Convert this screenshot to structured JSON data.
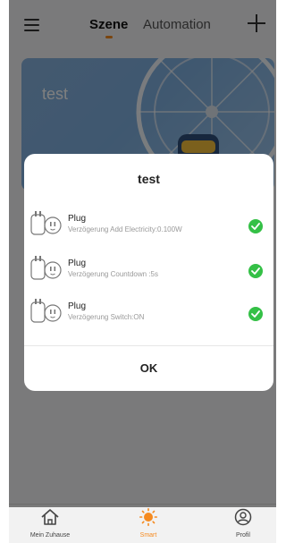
{
  "header": {
    "menu_icon": "hamburger-menu-icon",
    "tabs": [
      {
        "label": "Szene",
        "active": true
      },
      {
        "label": "Automation",
        "active": false
      }
    ],
    "add_icon": "plus-icon"
  },
  "scene_card": {
    "title": "test"
  },
  "dialog": {
    "title": "test",
    "tasks": [
      {
        "name": "Plug",
        "description": "Verzögerung Add Electricity:0.100W",
        "status": "success"
      },
      {
        "name": "Plug",
        "description": "Verzögerung Countdown :5s",
        "status": "success"
      },
      {
        "name": "Plug",
        "description": "Verzögerung Switch:ON",
        "status": "success"
      }
    ],
    "ok_label": "OK"
  },
  "bottom_nav": {
    "items": [
      {
        "label": "Mein Zuhause",
        "icon": "home-icon",
        "active": false
      },
      {
        "label": "Smart",
        "icon": "sun-icon",
        "active": true
      },
      {
        "label": "Profil",
        "icon": "user-icon",
        "active": false
      }
    ]
  },
  "colors": {
    "accent": "#f58a1f",
    "success": "#34c046",
    "overlay": "rgba(0,0,0,0.5)"
  }
}
